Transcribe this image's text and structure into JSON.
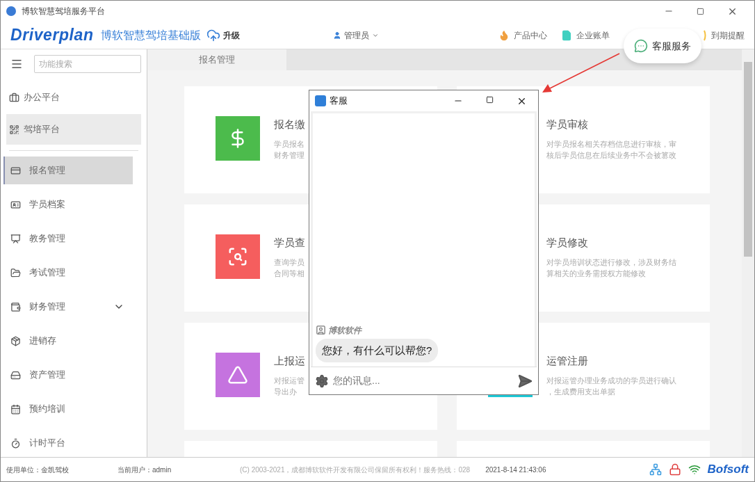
{
  "window": {
    "title": "博软智慧驾培服务平台"
  },
  "header": {
    "logo": "Driverplan",
    "edition": "博软智慧驾培基础版",
    "upgrade": "升级",
    "user": "管理员",
    "links": [
      {
        "label": "产品中心",
        "kind": "product"
      },
      {
        "label": "企业账单",
        "kind": "bill"
      },
      {
        "label": "到期提醒",
        "kind": "expiry"
      }
    ]
  },
  "callout": {
    "label": "客服服务"
  },
  "sidebar": {
    "search_placeholder": "功能搜索",
    "platforms": [
      {
        "label": "办公平台",
        "selected": false
      },
      {
        "label": "驾培平台",
        "selected": true
      }
    ],
    "items": [
      {
        "label": "报名管理",
        "selected": true,
        "kind": "item"
      },
      {
        "label": "学员档案",
        "selected": false,
        "kind": "item"
      },
      {
        "label": "教务管理",
        "selected": false,
        "kind": "item"
      },
      {
        "label": "考试管理",
        "selected": false,
        "kind": "item"
      },
      {
        "label": "财务管理",
        "selected": false,
        "kind": "group"
      },
      {
        "label": "进销存",
        "selected": false,
        "kind": "item"
      },
      {
        "label": "资产管理",
        "selected": false,
        "kind": "item"
      },
      {
        "label": "预约培训",
        "selected": false,
        "kind": "item"
      },
      {
        "label": "计时平台",
        "selected": false,
        "kind": "item"
      }
    ]
  },
  "tabs": [
    {
      "label": "报名管理",
      "selected": true
    }
  ],
  "cards": [
    {
      "title": "报名缴",
      "description": [
        "学员报名",
        "财务管理"
      ],
      "color": "#4cbb4c"
    },
    {
      "title": "学员审核",
      "description": [
        "对学员报名相关存档信息进行审核，审",
        "核后学员信息在后续业务中不会被篡改"
      ]
    },
    {
      "title": "学员查",
      "description": [
        "查询学员",
        "合同等相"
      ],
      "color": "#f55e5e"
    },
    {
      "title": "学员修改",
      "description": [
        "对学员培训状态进行修改，涉及财务结",
        "算相关的业务需授权方能修改"
      ]
    },
    {
      "title": "上报运",
      "description": [
        "对报运管",
        "导出办"
      ],
      "color": "#c573df"
    },
    {
      "title": "运管注册",
      "description": [
        "对报运管办理业务成功的学员进行确认",
        "，生成费用支出单据"
      ],
      "color": "#1fc8d6"
    }
  ],
  "chat": {
    "title": "客服",
    "sender": "博软软件",
    "message": "您好，有什么可以帮您?",
    "placeholder": "您的讯息..."
  },
  "status_bar": {
    "unit": "使用单位：金凯驾校",
    "user": "当前用户：admin",
    "copyright": "(C) 2003-2021，成都博软软件开发有限公司保留所有权利！服务热线：028",
    "datetime": "2021-8-14 21:43:06",
    "brand": "Bofsoft"
  }
}
